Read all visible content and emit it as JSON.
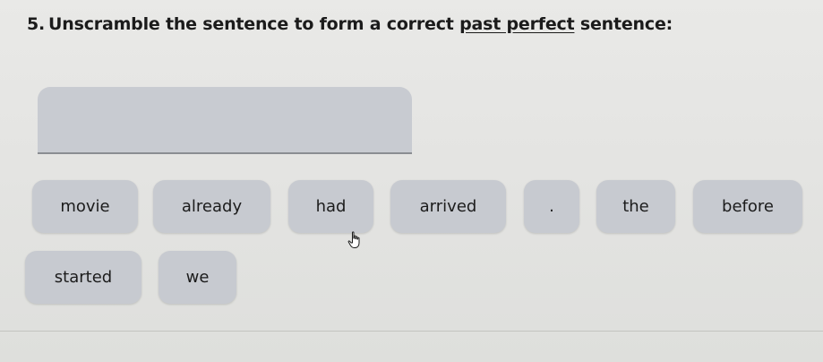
{
  "question": {
    "number": "5.",
    "text_before": "Unscramble the sentence to form a correct ",
    "underlined": "past perfect",
    "text_after": " sentence:"
  },
  "tiles": [
    {
      "label": "movie"
    },
    {
      "label": "already"
    },
    {
      "label": "had"
    },
    {
      "label": "arrived"
    },
    {
      "label": "."
    },
    {
      "label": "the"
    },
    {
      "label": "before"
    },
    {
      "label": "started"
    },
    {
      "label": "we"
    }
  ],
  "cursor_icon": "hand-pointer-icon"
}
